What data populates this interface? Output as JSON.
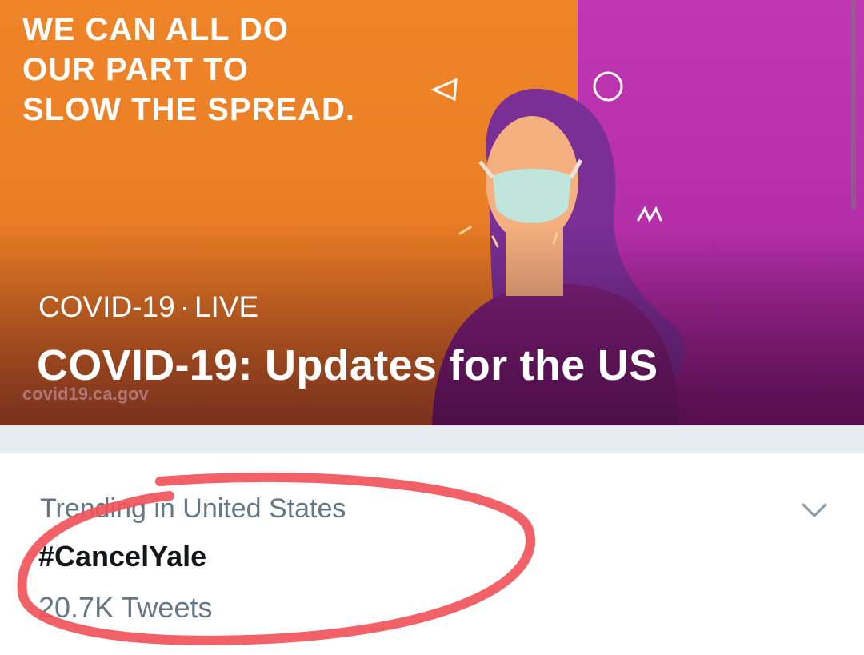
{
  "banner": {
    "slogan": "WE CAN ALL DO\nOUR PART TO\nSLOW THE SPREAD.",
    "watermark": "covid19.ca.gov",
    "category": "COVID-19",
    "separator": "·",
    "status": "LIVE",
    "headline": "COVID-19: Updates for the US"
  },
  "trend": {
    "context": "Trending in United States",
    "name": "#CancelYale",
    "count": "20.7K Tweets",
    "menu_icon": "chevron-down-icon"
  },
  "colors": {
    "orange": "#ef8429",
    "magenta": "#c037b4",
    "annotation_red": "#f0545a",
    "secondary_text": "#657786"
  }
}
